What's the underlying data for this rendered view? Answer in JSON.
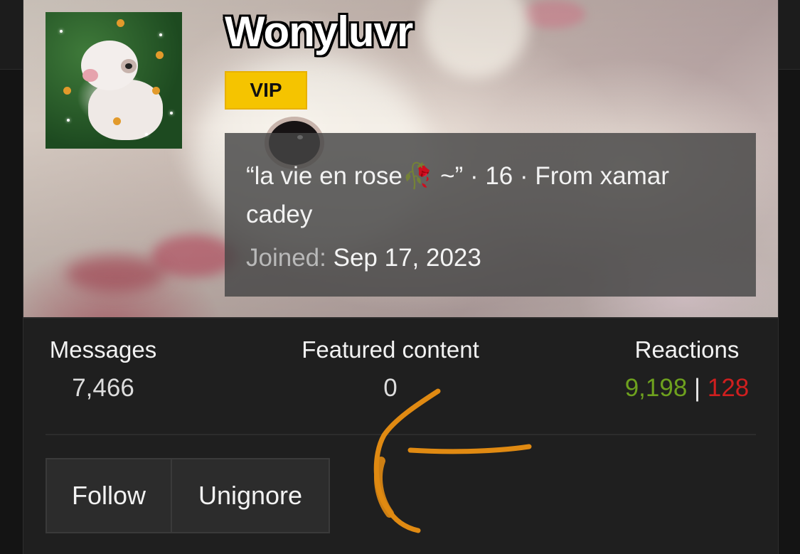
{
  "profile": {
    "username": "Wonyluvr",
    "badge": "VIP",
    "bio_before_emoji": "“la vie en rose",
    "bio_emoji": "🥀",
    "bio_after_emoji": " ~” · 16 · From xamar cadey",
    "joined_label": "Joined:",
    "joined_value": "Sep 17, 2023"
  },
  "stats": {
    "messages": {
      "label": "Messages",
      "value": "7,466"
    },
    "featured": {
      "label": "Featured content",
      "value": "0"
    },
    "reactions": {
      "label": "Reactions",
      "positive": "9,198",
      "separator": "|",
      "negative": "128"
    }
  },
  "actions": {
    "follow_label": "Follow",
    "unignore_label": "Unignore"
  },
  "colors": {
    "vip_badge": "#f5c400",
    "reactions_positive": "#6ea11e",
    "reactions_negative": "#cf1f1f",
    "annotation_stroke": "#e08a12"
  },
  "icons": {
    "bio_emoji": "wilted-rose-icon",
    "annotation": "hand-drawn-arrow-icon"
  }
}
